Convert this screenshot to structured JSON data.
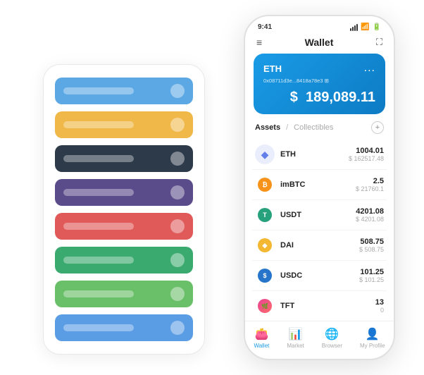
{
  "statusBar": {
    "time": "9:41",
    "icons": [
      "signal",
      "wifi",
      "battery"
    ]
  },
  "header": {
    "menu_icon": "≡",
    "title": "Wallet",
    "expand_icon": "⛶"
  },
  "ethCard": {
    "label": "ETH",
    "more": "...",
    "address": "0x08711d3e...8418a78e3  ⊞",
    "balance_symbol": "$",
    "balance": "189,089.11"
  },
  "assetsTabs": {
    "active": "Assets",
    "divider": "/",
    "inactive": "Collectibles"
  },
  "addButton": "+",
  "assets": [
    {
      "name": "ETH",
      "icon_type": "eth",
      "amount": "1004.01",
      "usd": "$ 162517.48"
    },
    {
      "name": "imBTC",
      "icon_type": "imbtc",
      "amount": "2.5",
      "usd": "$ 21760.1"
    },
    {
      "name": "USDT",
      "icon_type": "usdt",
      "amount": "4201.08",
      "usd": "$ 4201.08"
    },
    {
      "name": "DAI",
      "icon_type": "dai",
      "amount": "508.75",
      "usd": "$ 508.75"
    },
    {
      "name": "USDC",
      "icon_type": "usdc",
      "amount": "101.25",
      "usd": "$ 101.25"
    },
    {
      "name": "TFT",
      "icon_type": "tft",
      "amount": "13",
      "usd": "0"
    }
  ],
  "bottomNav": [
    {
      "label": "Wallet",
      "icon": "wallet",
      "active": true
    },
    {
      "label": "Market",
      "icon": "market",
      "active": false
    },
    {
      "label": "Browser",
      "icon": "browser",
      "active": false
    },
    {
      "label": "My Profile",
      "icon": "profile",
      "active": false
    }
  ],
  "cardStack": {
    "colors": [
      "blue",
      "yellow",
      "dark",
      "purple",
      "red",
      "green-dark",
      "green-light",
      "blue-light"
    ]
  }
}
